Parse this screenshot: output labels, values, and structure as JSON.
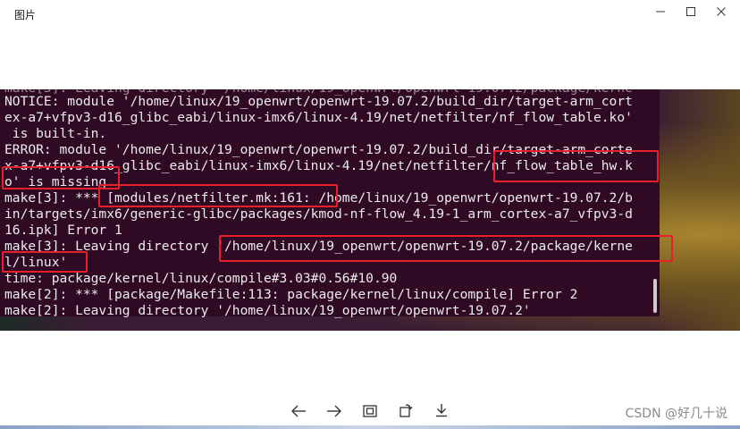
{
  "window": {
    "title": "图片",
    "controls": {
      "minimize_icon": "minimize-icon",
      "maximize_icon": "maximize-icon",
      "close_icon": "close-icon"
    }
  },
  "terminal": {
    "background": "#300a24",
    "lines": [
      "NOTICE: module '/home/linux/19_openwrt/openwrt-19.07.2/build_dir/target-arm_cort",
      "ex-a7+vfpv3-d16_glibc_eabi/linux-imx6/linux-4.19/net/netfilter/nf_flow_table.ko'",
      " is built-in.",
      "ERROR: module '/home/linux/19_openwrt/openwrt-19.07.2/build_dir/target-arm_corte",
      "x-a7+vfpv3-d16_glibc_eabi/linux-imx6/linux-4.19/net/netfilter/nf_flow_table_hw.k",
      "o' is missing.",
      "make[3]: *** [modules/netfilter.mk:161: /home/linux/19_openwrt/openwrt-19.07.2/b",
      "in/targets/imx6/generic-glibc/packages/kmod-nf-flow_4.19-1_arm_cortex-a7_vfpv3-d",
      "16.ipk] Error 1",
      "make[3]: Leaving directory '/home/linux/19_openwrt/openwrt-19.07.2/package/kerne",
      "l/linux'",
      "time: package/kernel/linux/compile#3.03#0.56#10.90",
      "make[2]: *** [package/Makefile:113: package/kernel/linux/compile] Error 2",
      "make[2]: Leaving directory '/home/linux/19_openwrt/openwrt-19.07.2'"
    ],
    "highlight_color": "#e8202c"
  },
  "toolbar": {
    "icons": [
      "arrow-left-icon",
      "arrow-right-icon",
      "fit-screen-icon",
      "rotate-icon",
      "download-icon"
    ]
  },
  "watermark": "CSDN @好几十说"
}
